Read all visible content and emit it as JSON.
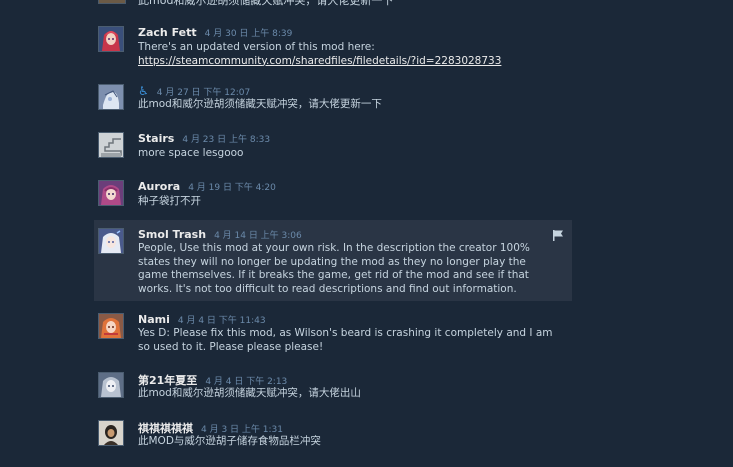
{
  "top_cutoff": "此mod和威尔逊胡须储藏天赋冲突，请大佬更新一下",
  "comments": [
    {
      "author": "Zach Fett",
      "time": "4 月 30 日 上午 8:39",
      "text": "There's an updated version of this mod here:",
      "link": "https://steamcommunity.com/sharedfiles/filedetails/?id=2283028733",
      "avatar": "red-haired-avatar"
    },
    {
      "author": "",
      "author_icon": "accessibility-icon",
      "author_glyph": "♿",
      "time": "4 月 27 日 下午 12:07",
      "text": "此mod和威尔逊胡须储藏天赋冲突，请大佬更新一下",
      "avatar": "blue-sketch-avatar"
    },
    {
      "author": "Stairs",
      "time": "4 月 23 日 上午 8:33",
      "text": "more space lesgooo",
      "avatar": "stairs-avatar"
    },
    {
      "author": "Aurora",
      "time": "4 月 19 日 下午 4:20",
      "text": "种子袋打不开",
      "avatar": "purple-anime-avatar"
    },
    {
      "author": "Smol Trash",
      "time": "4 月 14 日 上午 3:06",
      "text": "People, Use this mod at your own risk. In the description the creator 100% states they will no longer be updating the mod as they no longer play the game themselves. If it breaks the game, get rid of the mod and see if that works. It's not too difficult to read descriptions and find out information.",
      "avatar": "white-anime-avatar",
      "highlighted": true
    },
    {
      "author": "Nami",
      "time": "4 月 4 日 下午 11:43",
      "text": "Yes D: Please fix this mod, as Wilson's beard is crashing it completely and I am so used to it. Please please please!",
      "avatar": "orange-anime-avatar"
    },
    {
      "author": "第21年夏至",
      "time": "4 月 4 日 下午 2:13",
      "text": "此mod和威尔逊胡须储藏天赋冲突，请大佬出山",
      "avatar": "grey-anime-avatar"
    },
    {
      "author": "祺祺祺祺祺",
      "time": "4 月 3 日 上午 1:31",
      "text": "此MOD与威尔逊胡子储存食物品栏冲突",
      "avatar": "dark-character-avatar"
    }
  ],
  "colors": {
    "background": "#1b2838",
    "highlight": "#2a3545",
    "author": "#ebebeb",
    "timestamp": "#6b8aaa",
    "text": "#c6d4df"
  }
}
